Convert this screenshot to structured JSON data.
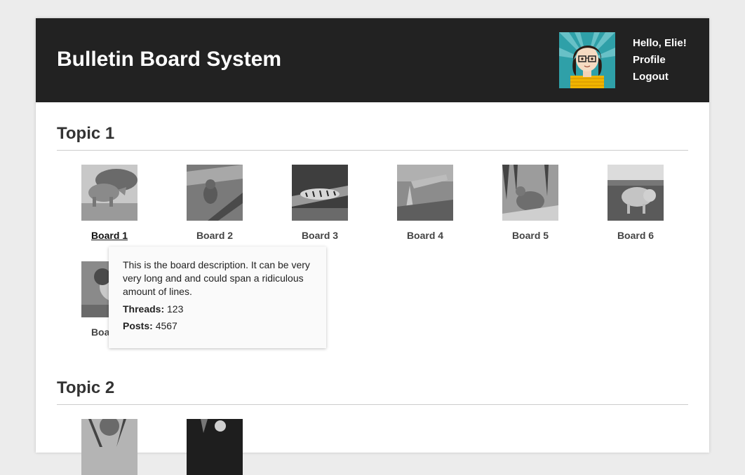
{
  "header": {
    "title": "Bulletin Board System",
    "greeting": "Hello, Elie!",
    "profile_link": "Profile",
    "logout_link": "Logout"
  },
  "topics": [
    {
      "title": "Topic 1",
      "boards": [
        {
          "label": "Board 1",
          "image": "rhinoceros-photo"
        },
        {
          "label": "Board 2",
          "image": "monkey-photo"
        },
        {
          "label": "Board 3",
          "image": "tiger-photo"
        },
        {
          "label": "Board 4",
          "image": "giraffe-photo"
        },
        {
          "label": "Board 5",
          "image": "deer-photo"
        },
        {
          "label": "Board 6",
          "image": "pig-photo"
        },
        {
          "label": "Board 7",
          "image": "cat-photo"
        }
      ]
    },
    {
      "title": "Topic 2",
      "boards": [
        {
          "label": "",
          "image": "tree-photo"
        },
        {
          "label": "",
          "image": "dark-photo"
        }
      ]
    }
  ],
  "tooltip": {
    "description": "This is the board description. It can be very very long and and could span a ridiculous amount of lines.",
    "threads_label": "Threads:",
    "threads_value": "123",
    "posts_label": "Posts:",
    "posts_value": "4567"
  }
}
